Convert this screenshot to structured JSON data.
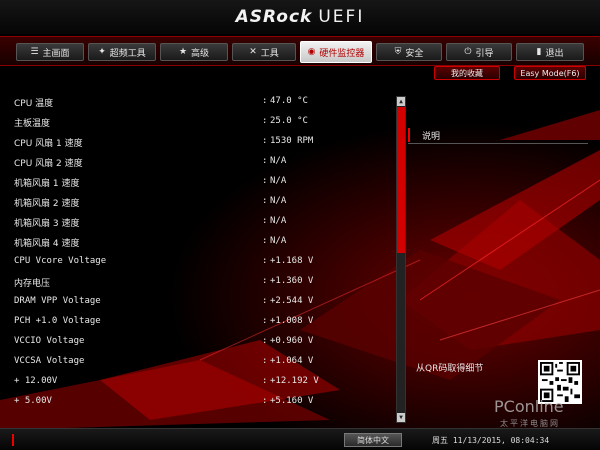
{
  "header": {
    "brand": "ASRock",
    "product": "UEFI"
  },
  "tabs": [
    {
      "label": "主画面",
      "icon": "list-icon",
      "glyph": "☰"
    },
    {
      "label": "超频工具",
      "icon": "gauge-icon",
      "glyph": "✦"
    },
    {
      "label": "高级",
      "icon": "star-icon",
      "glyph": "★"
    },
    {
      "label": "工具",
      "icon": "wrench-icon",
      "glyph": "✕"
    },
    {
      "label": "硬件监控器",
      "icon": "monitor-icon",
      "glyph": "◉"
    },
    {
      "label": "安全",
      "icon": "shield-icon",
      "glyph": "⛨"
    },
    {
      "label": "引导",
      "icon": "power-icon",
      "glyph": "⏻"
    },
    {
      "label": "退出",
      "icon": "exit-icon",
      "glyph": "▮"
    }
  ],
  "active_tab": 4,
  "quick_buttons": {
    "favorites": "我的收藏",
    "easy_mode": "Easy Mode(F6)"
  },
  "monitor_rows": [
    {
      "label": "CPU 温度",
      "value": "47.0 °C"
    },
    {
      "label": "主板温度",
      "value": "25.0 °C"
    },
    {
      "label": "CPU 风扇 1 速度",
      "value": "1530 RPM"
    },
    {
      "label": "CPU 风扇 2 速度",
      "value": "N/A"
    },
    {
      "label": "机箱风扇 1 速度",
      "value": "N/A"
    },
    {
      "label": "机箱风扇 2 速度",
      "value": "N/A"
    },
    {
      "label": "机箱风扇 3 速度",
      "value": "N/A"
    },
    {
      "label": "机箱风扇 4 速度",
      "value": "N/A"
    },
    {
      "label": "CPU Vcore Voltage",
      "value": "+1.168 V"
    },
    {
      "label": "内存电压",
      "value": "+1.360 V"
    },
    {
      "label": "DRAM VPP Voltage",
      "value": "+2.544 V"
    },
    {
      "label": "PCH +1.0 Voltage",
      "value": "+1.008 V"
    },
    {
      "label": "VCCIO Voltage",
      "value": "+0.960 V"
    },
    {
      "label": "VCCSA Voltage",
      "value": "+1.064 V"
    },
    {
      "label": "+ 12.00V",
      "value": "+12.192 V"
    },
    {
      "label": "+ 5.00V",
      "value": "+5.160 V"
    }
  ],
  "colon": ":",
  "scroll": {
    "up": "▲",
    "down": "▼"
  },
  "description_title": "说明",
  "qr_label": "从QR码取得细节",
  "footer": {
    "language": "简体中文",
    "datetime": "周五 11/13/2015, 08:04:34"
  },
  "watermark": {
    "brand": "PConline",
    "sub": "太平洋电脑网"
  },
  "colors": {
    "accent": "#d30000",
    "tabbar": "#2a0000",
    "background": "#000000"
  }
}
